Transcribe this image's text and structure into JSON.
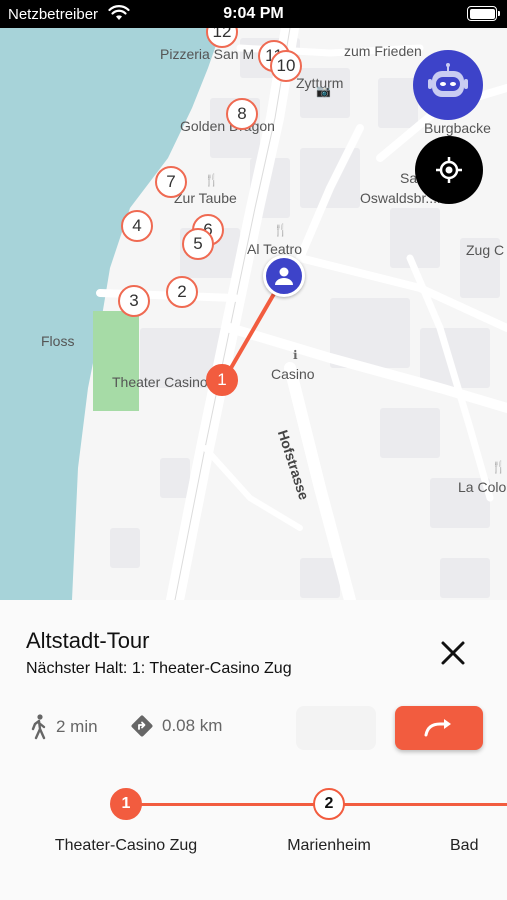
{
  "status_bar": {
    "carrier": "Netzbetreiber",
    "time": "9:04 PM",
    "wifi_icon": "wifi-icon",
    "battery_icon": "battery-icon"
  },
  "map": {
    "labels": {
      "pizzeria": "Pizzeria San M",
      "zum_frieden": "zum Frieden",
      "zytturm": "Zytturm",
      "golden_dragon": "Golden Dragon",
      "burgbacke": "Burgbacke",
      "zur_taube": "Zur Taube",
      "oswald_1": "Sa",
      "oswald_2": "Oswaldsbr...n",
      "al_teatro": "Al Teatro",
      "zug_c": "Zug C",
      "floss": "Floss",
      "theater": "Theater Casino Zug",
      "casino": "Casino",
      "hofstrasse": "Hofstrasse",
      "la_colo": "La Colo"
    },
    "markers": [
      "12",
      "11",
      "10",
      "8",
      "7",
      "6",
      "5",
      "4",
      "2",
      "3",
      "1"
    ],
    "active_marker": "1",
    "accent_color": "#f25c3f",
    "user_color": "#3d43c9"
  },
  "panel": {
    "title": "Altstadt-Tour",
    "next_stop": "Nächster Halt: 1: Theater-Casino Zug",
    "walk_time": "2 min",
    "distance": "0.08 km",
    "stops": [
      {
        "number": "1",
        "name": "Theater-Casino Zug"
      },
      {
        "number": "2",
        "name": "Marienheim"
      },
      {
        "number": "",
        "name": "Bad"
      }
    ]
  }
}
